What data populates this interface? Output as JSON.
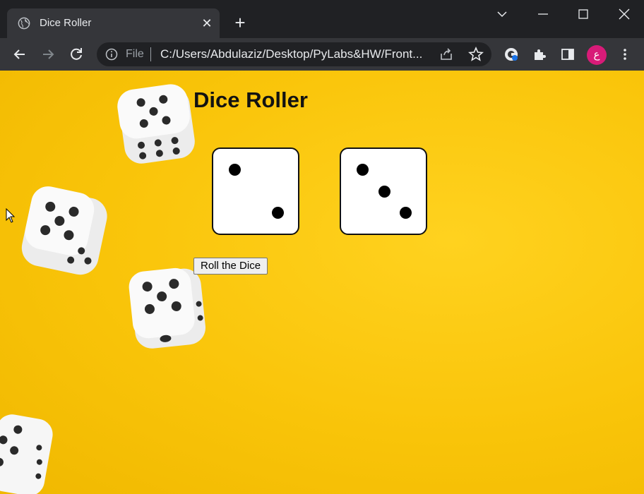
{
  "browser": {
    "tab_title": "Dice Roller",
    "tab_close": "✕",
    "new_tab": "+",
    "address": {
      "file_label": "File",
      "url": "C:/Users/Abdulaziz/Desktop/PyLabs&HW/Front..."
    },
    "profile_initial": "ع"
  },
  "page": {
    "title": "Dice Roller",
    "roll_button_label": "Roll the Dice",
    "dice_values": [
      2,
      3
    ]
  },
  "colors": {
    "background": "#f9c409",
    "avatar": "#d81b78"
  }
}
